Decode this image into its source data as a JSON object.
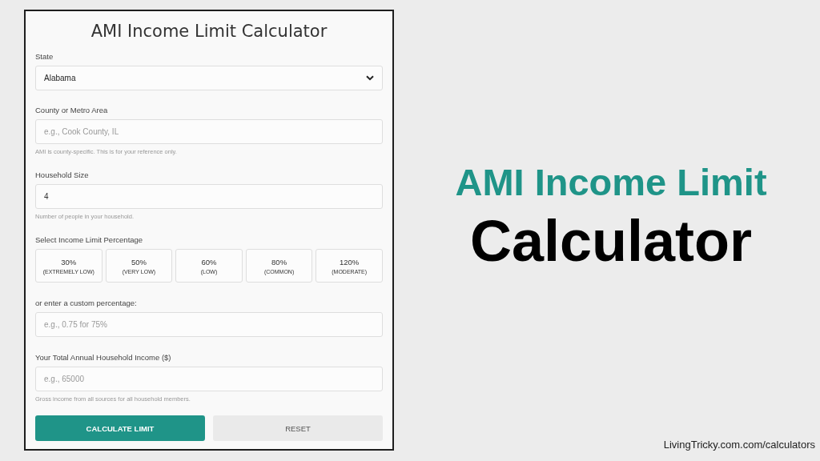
{
  "calculator": {
    "title": "AMI Income Limit Calculator",
    "state": {
      "label": "State",
      "value": "Alabama"
    },
    "county": {
      "label": "County or Metro Area",
      "placeholder": "e.g., Cook County, IL",
      "hint": "AMI is county-specific. This is for your reference only."
    },
    "household_size": {
      "label": "Household Size",
      "value": "4",
      "hint": "Number of people in your household."
    },
    "percentage": {
      "label": "Select Income Limit Percentage",
      "options": [
        {
          "value": "30%",
          "caption": "(EXTREMELY LOW)",
          "selected": false
        },
        {
          "value": "50%",
          "caption": "(VERY LOW)",
          "selected": false
        },
        {
          "value": "60%",
          "caption": "(LOW)",
          "selected": false
        },
        {
          "value": "80%",
          "caption": "(COMMON)",
          "selected": false
        },
        {
          "value": "120%",
          "caption": "(MODERATE)",
          "selected": false
        }
      ]
    },
    "custom": {
      "label": "or enter a custom percentage:",
      "placeholder": "e.g., 0.75 for 75%"
    },
    "income": {
      "label": "Your Total Annual Household Income ($)",
      "placeholder": "e.g., 65000",
      "hint": "Gross income from all sources for all household members."
    },
    "buttons": [
      {
        "label": "CALCULATE LIMIT",
        "kind": "primary"
      },
      {
        "label": "RESET",
        "kind": "secondary"
      }
    ]
  },
  "headline": {
    "line_1": "AMI Income Limit",
    "line_2": "Calculator"
  },
  "footer": "LivingTricky.com.com/calculators"
}
